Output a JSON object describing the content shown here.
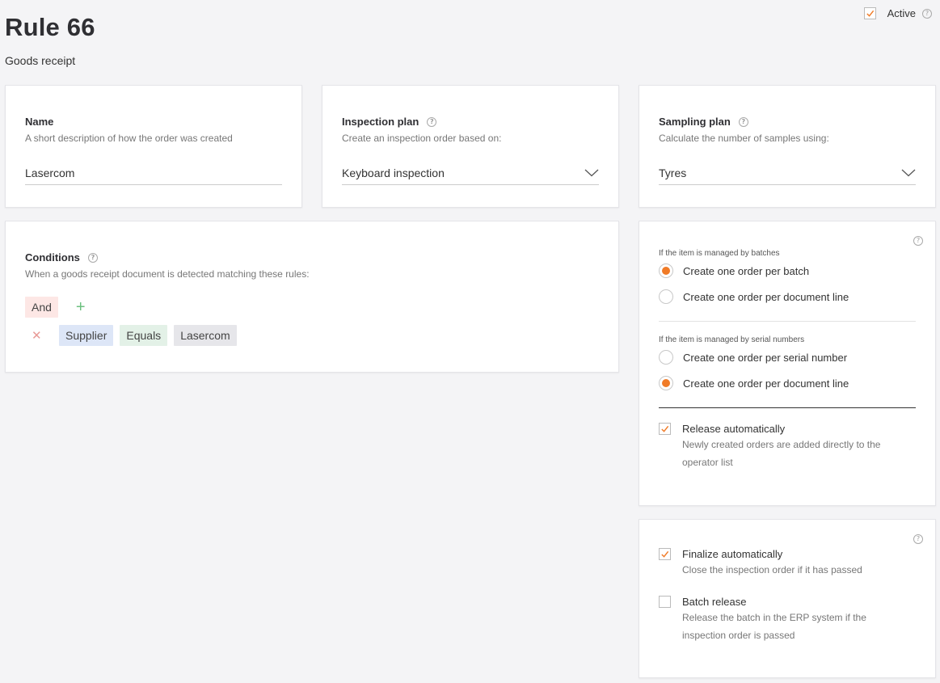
{
  "page": {
    "title": "Rule 66",
    "subtitle": "Goods receipt"
  },
  "active": {
    "label": "Active",
    "checked": true
  },
  "name_card": {
    "title": "Name",
    "description": "A short description of how the order was created",
    "value": "Lasercom"
  },
  "inspection_card": {
    "title": "Inspection plan",
    "description": "Create an inspection order based on:",
    "selected": "Keyboard inspection"
  },
  "sampling_card": {
    "title": "Sampling plan",
    "description": "Calculate the number of samples using:",
    "selected": "Tyres"
  },
  "conditions_card": {
    "title": "Conditions",
    "description": "When a goods receipt document is detected matching these rules:",
    "operator": "And",
    "rule": {
      "field": "Supplier",
      "comparator": "Equals",
      "value": "Lasercom"
    }
  },
  "order_options": {
    "batches": {
      "label": "If the item is managed by batches",
      "options": [
        "Create one order per batch",
        "Create one order per document line"
      ],
      "selected_index": 0
    },
    "serials": {
      "label": "If the item is managed by serial numbers",
      "options": [
        "Create one order per serial number",
        "Create one order per document line"
      ],
      "selected_index": 1
    },
    "release": {
      "title": "Release automatically",
      "description_line1": "Newly created orders are added directly to the",
      "description_line2": "operator list",
      "checked": true
    }
  },
  "finalize_options": {
    "finalize": {
      "title": "Finalize automatically",
      "description": "Close the inspection order if it has passed",
      "checked": true
    },
    "batch_release": {
      "title": "Batch release",
      "description_line1": "Release the batch in the ERP system if the",
      "description_line2": "inspection order is passed",
      "checked": false
    }
  },
  "colors": {
    "accent": "#f07b27",
    "background": "#f4f4f6",
    "chip_and": "#fde7e5",
    "chip_field": "#dde6f7",
    "chip_comparator": "#e3f1e7",
    "chip_value": "#e6e6ea"
  },
  "icons": {
    "help": "help-icon",
    "check": "check-icon",
    "dropdown": "chevron-down-icon",
    "add": "plus-icon",
    "remove": "close-icon"
  }
}
